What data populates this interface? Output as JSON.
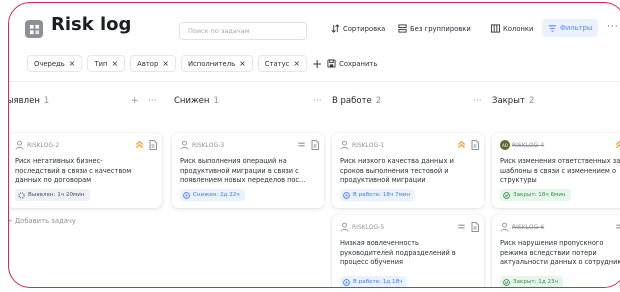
{
  "header": {
    "title": "Risk log",
    "search_placeholder": "Поиск по задачам",
    "sort": "Сортировка",
    "grouping": "Без группировки",
    "columns": "Колонки",
    "filters": "Фильтры",
    "more": "···"
  },
  "filters": {
    "chips": [
      "Очередь",
      "Тип",
      "Автор",
      "Исполнитель",
      "Статус"
    ],
    "remove_glyph": "×",
    "add_glyph": "+",
    "save_label": "Сохранить"
  },
  "columns": [
    {
      "name": "Выявлен",
      "count": "1",
      "add_glyph": "+",
      "more": "···",
      "add_task": "+ Добавить задачу"
    },
    {
      "name": "Снижен",
      "count": "1",
      "more": "···"
    },
    {
      "name": "В работе",
      "count": "2",
      "more": "···"
    },
    {
      "name": "Закрыт",
      "count": "2"
    }
  ],
  "cards": [
    {
      "key": "RISKLOG-2",
      "priority": "high",
      "summary": [
        "Риск негативных бизнес-",
        "последствий в связи с качеством",
        "данных по договорам"
      ],
      "status": "Выявлен: 1ч 20мин",
      "status_kind": "open"
    },
    {
      "key": "RISKLOG-3",
      "priority": "normal",
      "summary": [
        "Риск выполнения операций на",
        "продуктивной миграции в связи с",
        "появлением новых переделов пос..."
      ],
      "status": "Снижен: 2д 22ч",
      "status_kind": "low"
    },
    {
      "key": "RISKLOG-1",
      "priority": "high",
      "summary": [
        "Риск низкого качества данных и",
        "сроков выполнения тестовой и",
        "продуктивной миграции"
      ],
      "status": "В работе: 18ч 7мин",
      "status_kind": "prog"
    },
    {
      "key": "RISKLOG-5",
      "priority": "normal",
      "summary": [
        "Низкая вовлеченность",
        "руководителей подразделений в",
        "процесс обучения"
      ],
      "status": "В работе: 1д 18ч",
      "status_kind": "prog"
    },
    {
      "key": "RISKLOG-4",
      "priority": "high",
      "summary": [
        "Риск изменения ответственных за",
        "шаблоны в связи с изменением о",
        "структуры"
      ],
      "status": "Закрыт: 18ч 6мин",
      "status_kind": "done",
      "avatar_initials": "АО"
    },
    {
      "key": "RISKLOG-6",
      "priority": "normal",
      "summary": [
        "Риск нарушения пропускного",
        "режима вследствии потери",
        "актуальности данных о сотрудник"
      ],
      "status": "Закрыт: 1д 23ч",
      "status_kind": "done"
    }
  ],
  "colors": {
    "accent": "#4f86f7",
    "frame": "#d6294f",
    "priority_high": "#f5a524",
    "done": "#3a8b4d"
  }
}
